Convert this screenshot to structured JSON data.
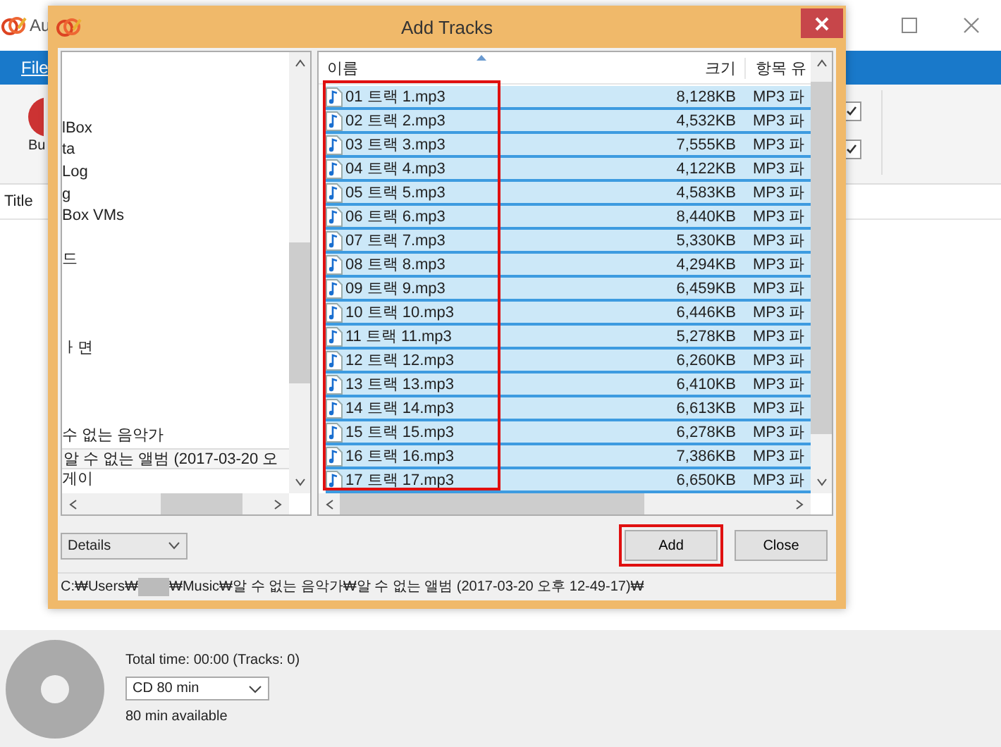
{
  "app": {
    "title": "Au",
    "menu": "File",
    "ribbon_button": "Bu",
    "column": "Title",
    "checkboxes": [
      {
        "checked": true
      },
      {
        "checked": true
      }
    ]
  },
  "dialog": {
    "title": "Add Tracks",
    "folders": [
      {
        "label": "lBox",
        "selected": false
      },
      {
        "label": "ta",
        "selected": false
      },
      {
        "label": "Log",
        "selected": false
      },
      {
        "label": "g",
        "selected": false
      },
      {
        "label": "Box VMs",
        "selected": false
      },
      {
        "label": "드",
        "selected": false
      },
      {
        "label": "ㅏ면",
        "selected": false
      },
      {
        "label": "수 없는 음악가",
        "selected": false
      },
      {
        "label": "알 수 없는 앨범 (2017-03-20 오",
        "selected": true
      },
      {
        "label": "게이",
        "selected": false
      }
    ],
    "columns": [
      "이름",
      "크기",
      "항목 유"
    ],
    "names_highlighted": true,
    "files": [
      {
        "name": "01 트랙 1.mp3",
        "size": "8,128KB",
        "type": "MP3 파",
        "selected": true
      },
      {
        "name": "02 트랙 2.mp3",
        "size": "4,532KB",
        "type": "MP3 파",
        "selected": true
      },
      {
        "name": "03 트랙 3.mp3",
        "size": "7,555KB",
        "type": "MP3 파",
        "selected": true
      },
      {
        "name": "04 트랙 4.mp3",
        "size": "4,122KB",
        "type": "MP3 파",
        "selected": true
      },
      {
        "name": "05 트랙 5.mp3",
        "size": "4,583KB",
        "type": "MP3 파",
        "selected": true
      },
      {
        "name": "06 트랙 6.mp3",
        "size": "8,440KB",
        "type": "MP3 파",
        "selected": true
      },
      {
        "name": "07 트랙 7.mp3",
        "size": "5,330KB",
        "type": "MP3 파",
        "selected": true
      },
      {
        "name": "08 트랙 8.mp3",
        "size": "4,294KB",
        "type": "MP3 파",
        "selected": true
      },
      {
        "name": "09 트랙 9.mp3",
        "size": "6,459KB",
        "type": "MP3 파",
        "selected": true
      },
      {
        "name": "10 트랙 10.mp3",
        "size": "6,446KB",
        "type": "MP3 파",
        "selected": true
      },
      {
        "name": "11 트랙 11.mp3",
        "size": "5,278KB",
        "type": "MP3 파",
        "selected": true
      },
      {
        "name": "12 트랙 12.mp3",
        "size": "6,260KB",
        "type": "MP3 파",
        "selected": true
      },
      {
        "name": "13 트랙 13.mp3",
        "size": "6,410KB",
        "type": "MP3 파",
        "selected": true
      },
      {
        "name": "14 트랙 14.mp3",
        "size": "6,613KB",
        "type": "MP3 파",
        "selected": true
      },
      {
        "name": "15 트랙 15.mp3",
        "size": "6,278KB",
        "type": "MP3 파",
        "selected": true
      },
      {
        "name": "16 트랙 16.mp3",
        "size": "7,386KB",
        "type": "MP3 파",
        "selected": true
      },
      {
        "name": "17 트랙 17.mp3",
        "size": "6,650KB",
        "type": "MP3 파",
        "selected": true
      }
    ],
    "view": "Details",
    "buttons": [
      {
        "label": "Add",
        "highlighted": true
      },
      {
        "label": "Close",
        "highlighted": false
      }
    ],
    "path_before": "C:₩Users₩",
    "path_after": "₩Music₩알 수 없는 음악가₩알 수 없는 앨범 (2017-03-20 오후 12-49-17)₩"
  },
  "summary": {
    "total": "Total time: 00:00 (Tracks: 0)",
    "media": "CD 80 min",
    "available": "80 min available"
  }
}
